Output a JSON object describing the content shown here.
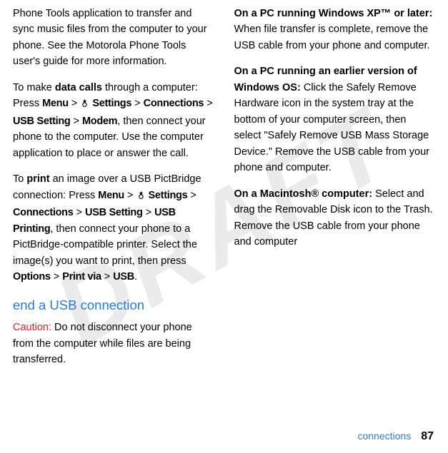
{
  "watermark": "DRAFT",
  "left": {
    "intro": "Phone Tools application to transfer and sync music files from the computer to your phone. See the Motorola Phone Tools user's guide for more information.",
    "datacalls_pre": "To make ",
    "datacalls_bold": "data calls",
    "datacalls_post": " through a computer: Press ",
    "menu1": "Menu",
    "gt": ">",
    "settings1": "Settings",
    "connections1": "Connections",
    "usbsetting1": "USB Setting",
    "modem": "Modem",
    "datacalls_tail": ", then connect your phone to the computer. Use the computer application to place or answer the call.",
    "print_pre": "To ",
    "print_bold": "print",
    "print_mid": " an image over a USB PictBridge connection: Press ",
    "menu2": "Menu",
    "settings2": "Settings",
    "connections2": "Connections",
    "usbsetting2": "USB Setting",
    "usbprinting": "USB Printing",
    "print_mid2": ", then connect your phone to a PictBridge-compatible printer. Select the image(s) you want to print, then press ",
    "options": "Options",
    "printvia": "Print via",
    "usb": "USB",
    "period": ".",
    "heading": "end a USB connection",
    "caution_label": "Caution:",
    "caution_text": " Do not disconnect your phone from the computer while files are being transferred."
  },
  "right": {
    "xp_bold": "On a PC running Windows XP™ or later:",
    "xp_text": " When file transfer is complete, remove the USB cable from your phone and computer.",
    "earlier_bold": "On a PC running an earlier version of Windows OS:",
    "earlier_text": " Click the Safely Remove Hardware icon in the system tray at the bottom of your computer screen, then select \"Safely Remove USB Mass Storage Device.\" Remove the USB cable from your phone and computer.",
    "mac_bold": "On a Macintosh® computer:",
    "mac_text": " Select and drag the Removable Disk icon to the Trash. Remove the USB cable from your phone and computer"
  },
  "footer": {
    "section": "connections",
    "page": "87"
  }
}
